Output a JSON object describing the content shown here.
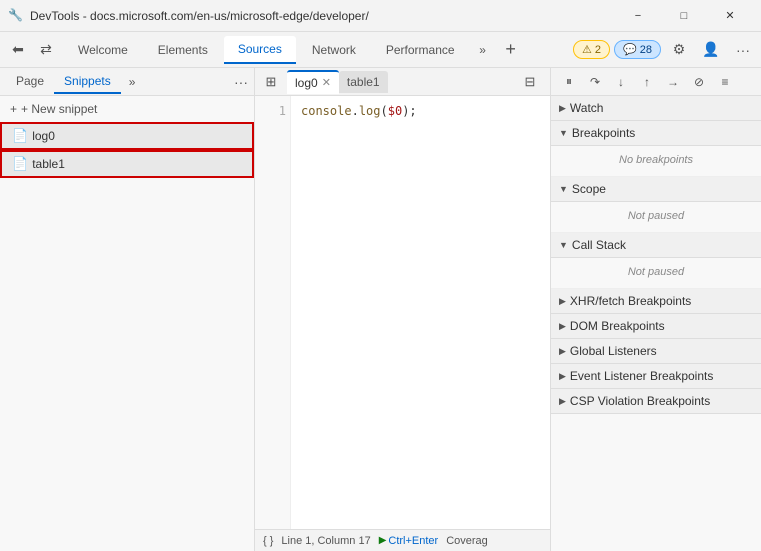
{
  "titleBar": {
    "favicon": "🔧",
    "title": "DevTools - docs.microsoft.com/en-us/microsoft-edge/developer/",
    "minimizeLabel": "−",
    "maximizeLabel": "□",
    "closeLabel": "✕"
  },
  "mainToolbar": {
    "navBack": "←",
    "navForward": "⇄",
    "tabs": [
      {
        "label": "Welcome",
        "active": false
      },
      {
        "label": "Elements",
        "active": false
      },
      {
        "label": "Sources",
        "active": true
      },
      {
        "label": "Network",
        "active": false
      },
      {
        "label": "Performance",
        "active": false
      }
    ],
    "moreTabs": "»",
    "newTab": "+",
    "badgeWarn": {
      "icon": "⚠",
      "count": "2"
    },
    "badgeInfo": {
      "icon": "💬",
      "count": "28"
    },
    "settingsIcon": "⚙",
    "profileIcon": "👤",
    "moreIcon": "···"
  },
  "sidebar": {
    "tabs": [
      {
        "label": "Page",
        "active": false
      },
      {
        "label": "Snippets",
        "active": true
      }
    ],
    "moreLabel": "»",
    "menuLabel": "···",
    "newSnippetLabel": "+ New snippet",
    "snippets": [
      {
        "name": "log0",
        "selected": true
      },
      {
        "name": "table1",
        "selected": true
      }
    ]
  },
  "editor": {
    "panelBtn": "⊞",
    "tabs": [
      {
        "label": "log0",
        "active": true,
        "hasClose": true
      },
      {
        "label": "table1",
        "active": false,
        "hasClose": false
      }
    ],
    "collapseBtn": "⊟",
    "lines": [
      "1"
    ],
    "code": "console.log($0);",
    "statusLine": "{ }",
    "positionLabel": "Line 1, Column 17",
    "runLabel": "Ctrl+Enter",
    "coverageLabel": "Coverag"
  },
  "rightPanel": {
    "tools": [
      "⏸",
      "▶",
      "⬇",
      "⬆",
      "➡",
      "⊘",
      "≡"
    ],
    "sections": [
      {
        "label": "Watch",
        "expanded": false,
        "arrow": "right",
        "content": null
      },
      {
        "label": "Breakpoints",
        "expanded": true,
        "arrow": "down",
        "emptyText": "No breakpoints",
        "content": "empty"
      },
      {
        "label": "Scope",
        "expanded": true,
        "arrow": "down",
        "emptyText": "Not paused",
        "content": "empty"
      },
      {
        "label": "Call Stack",
        "expanded": true,
        "arrow": "down",
        "emptyText": "Not paused",
        "content": "empty"
      },
      {
        "label": "XHR/fetch Breakpoints",
        "expanded": false,
        "arrow": "right",
        "content": null
      },
      {
        "label": "DOM Breakpoints",
        "expanded": false,
        "arrow": "right",
        "content": null
      },
      {
        "label": "Global Listeners",
        "expanded": false,
        "arrow": "right",
        "content": null
      },
      {
        "label": "Event Listener Breakpoints",
        "expanded": false,
        "arrow": "right",
        "content": null
      },
      {
        "label": "CSP Violation Breakpoints",
        "expanded": false,
        "arrow": "right",
        "content": null
      }
    ]
  }
}
